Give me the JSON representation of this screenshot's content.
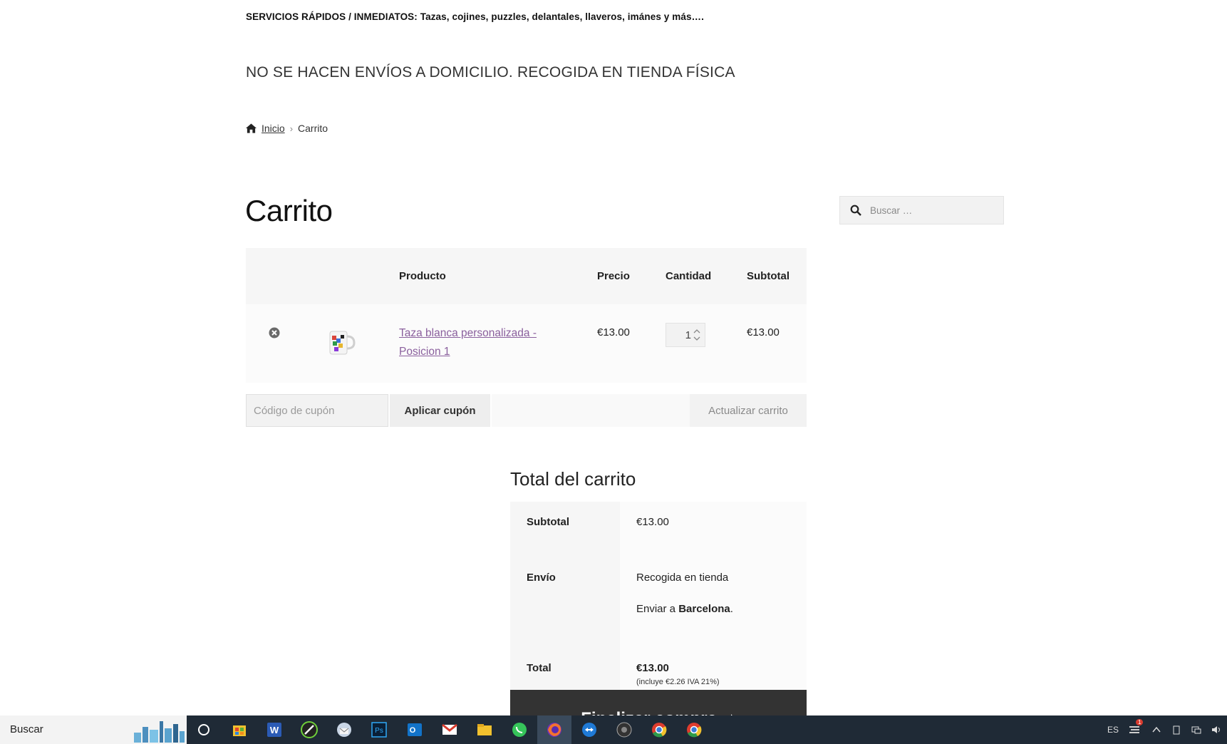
{
  "store": {
    "top_banner": "SERVICIOS RÁPIDOS / INMEDIATOS: Tazas, cojines, puzzles, delantales, llaveros, imánes y más….",
    "notice": "NO SE HACEN ENVÍOS A DOMICILIO. RECOGIDA EN TIENDA FÍSICA"
  },
  "breadcrumb": {
    "home": "Inicio",
    "current": "Carrito"
  },
  "page_title": "Carrito",
  "search": {
    "placeholder": "Buscar …"
  },
  "cart_table": {
    "headers": {
      "product": "Producto",
      "price": "Precio",
      "quantity": "Cantidad",
      "subtotal": "Subtotal"
    },
    "items": [
      {
        "name": "Taza blanca personalizada - Posicion 1",
        "price": "€13.00",
        "quantity": "1",
        "subtotal": "€13.00"
      }
    ]
  },
  "coupon": {
    "placeholder": "Código de cupón",
    "apply_label": "Aplicar cupón",
    "update_label": "Actualizar carrito"
  },
  "totals": {
    "title": "Total del carrito",
    "subtotal_label": "Subtotal",
    "subtotal_value": "€13.00",
    "shipping_label": "Envío",
    "shipping_method": "Recogida en tienda",
    "ship_to_prefix": "Enviar a ",
    "ship_to_city": "Barcelona",
    "ship_to_suffix": ".",
    "total_label": "Total",
    "total_value": "€13.00",
    "tax_note": "(incluye €2.26 IVA 21%)"
  },
  "checkout_label": "Finalizar compra  ➞",
  "taskbar": {
    "search_label": "Buscar",
    "language": "ES",
    "notification_count": "1",
    "apps": [
      "cortana-icon",
      "store-icon",
      "word-icon",
      "inkscape-icon",
      "thunderbird-icon",
      "photoshop-icon",
      "outlook-icon",
      "gmail-icon",
      "file-explorer-icon",
      "whatsapp-icon",
      "firefox-icon",
      "teamviewer-icon",
      "obs-icon",
      "chrome-icon",
      "chrome-icon"
    ]
  }
}
